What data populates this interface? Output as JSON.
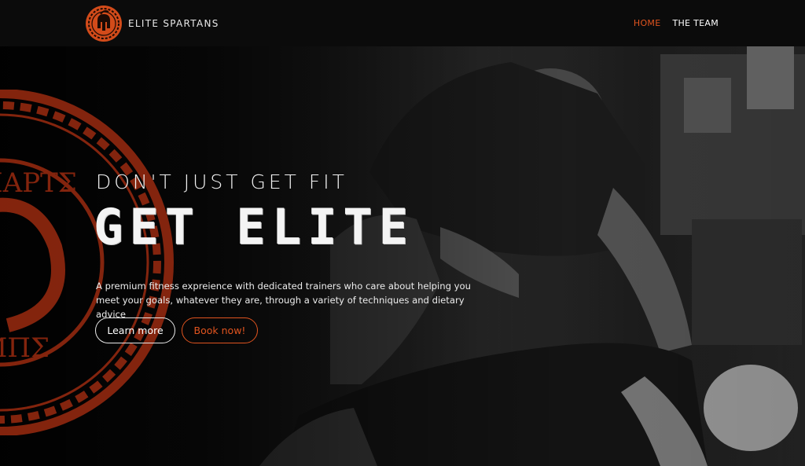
{
  "brand": {
    "name": "ELITE SPARTANS",
    "logo_icon": "spartan-helmet-icon"
  },
  "nav": {
    "items": [
      {
        "label": "HOME",
        "active": true
      },
      {
        "label": "THE TEAM",
        "active": false
      }
    ]
  },
  "hero": {
    "pre_title": "DON'T JUST GET FIT",
    "title": "GET ELITE",
    "description": "A premium fitness expreience with dedicated trainers who care about helping you meet your goals, whatever they are, through a variety of techniques and dietary advice",
    "buttons": {
      "learn_more": "Learn more",
      "book_now": "Book now!"
    },
    "seal_text": [
      "ΣΠΑΡΤΣ",
      "ΛΜΠΣ"
    ]
  },
  "colors": {
    "accent": "#e0541f",
    "background": "#0d0d0d",
    "seal": "#9a2a10"
  }
}
